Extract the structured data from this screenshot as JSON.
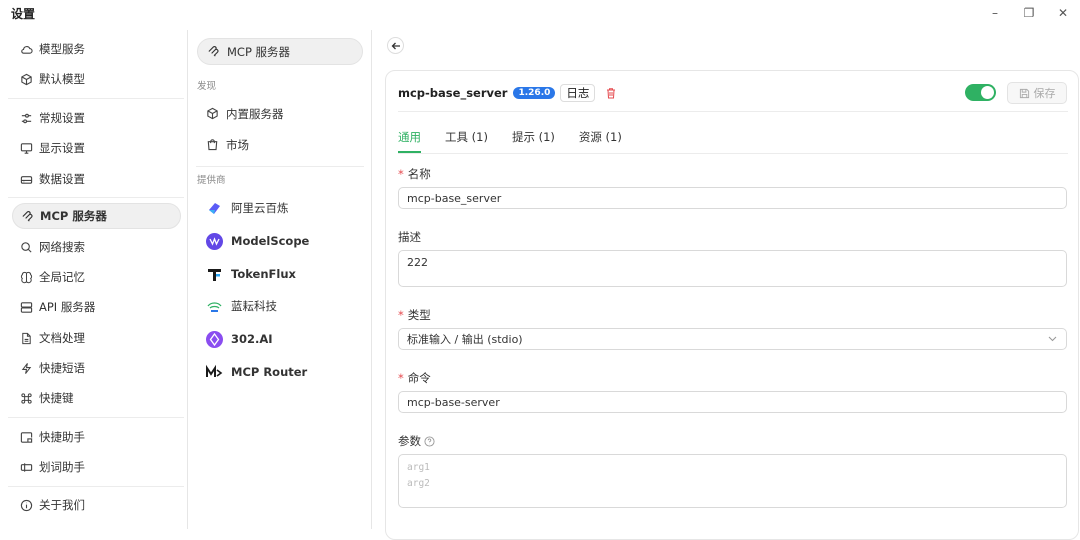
{
  "window": {
    "title": "设置",
    "minimize_icon": "–",
    "restore_icon": "❐",
    "close_icon": "✕"
  },
  "nav": {
    "items": [
      {
        "label": "模型服务",
        "icon": "cloud-icon"
      },
      {
        "label": "默认模型",
        "icon": "cube-icon"
      },
      {
        "label": "常规设置",
        "icon": "sliders-icon"
      },
      {
        "label": "显示设置",
        "icon": "monitor-icon"
      },
      {
        "label": "数据设置",
        "icon": "drive-icon"
      },
      {
        "label": "MCP 服务器",
        "icon": "mcp-icon",
        "active": true
      },
      {
        "label": "网络搜索",
        "icon": "search-icon"
      },
      {
        "label": "全局记忆",
        "icon": "brain-icon"
      },
      {
        "label": "API 服务器",
        "icon": "server-icon"
      },
      {
        "label": "文档处理",
        "icon": "document-icon"
      },
      {
        "label": "快捷短语",
        "icon": "zap-icon"
      },
      {
        "label": "快捷键",
        "icon": "command-icon"
      },
      {
        "label": "快捷助手",
        "icon": "app-window-icon"
      },
      {
        "label": "划词助手",
        "icon": "text-select-icon"
      },
      {
        "label": "关于我们",
        "icon": "info-icon"
      }
    ]
  },
  "mcp_menu": {
    "header": "MCP 服务器",
    "discover_caption": "发现",
    "builtin": "内置服务器",
    "market": "市场",
    "providers_caption": "提供商",
    "providers": [
      "阿里云百炼",
      "ModelScope",
      "TokenFlux",
      "蓝耘科技",
      "302.AI",
      "MCP Router"
    ]
  },
  "server": {
    "name": "mcp-base_server",
    "version": "1.26.0",
    "log_label": "日志",
    "enabled": true,
    "save_label": "保存",
    "tabs": [
      "通用",
      "工具 (1)",
      "提示 (1)",
      "资源 (1)"
    ],
    "fields": {
      "name_label": "名称",
      "name_value": "mcp-base_server",
      "desc_label": "描述",
      "desc_value": "222",
      "type_label": "类型",
      "type_value": "标准输入 / 输出 (stdio)",
      "command_label": "命令",
      "command_value": "mcp-base-server",
      "args_label": "参数",
      "args_placeholder_1": "arg1",
      "args_placeholder_2": "arg2"
    }
  },
  "colors": {
    "accent": "#2fb163",
    "version_badge": "#2a77e8",
    "required": "#e5484d"
  }
}
